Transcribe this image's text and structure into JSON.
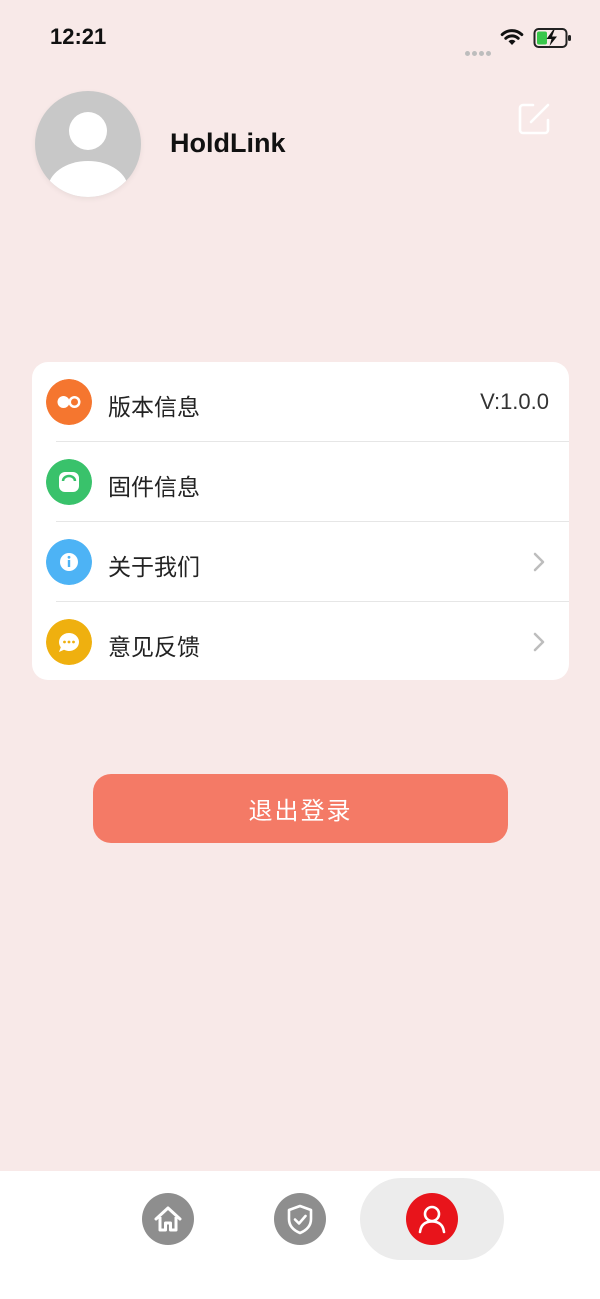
{
  "status_bar": {
    "time": "12:21",
    "icons": [
      "signal-dots-icon",
      "wifi-icon",
      "battery-charging-icon"
    ]
  },
  "profile": {
    "username": "HoldLink",
    "avatar_icon": "user-avatar-placeholder",
    "edit_icon": "edit-icon"
  },
  "menu": {
    "items": [
      {
        "label": "版本信息",
        "value": "V:1.0.0",
        "icon": "version-icon",
        "icon_color": "#f5762f",
        "chevron": false
      },
      {
        "label": "固件信息",
        "value": "",
        "icon": "firmware-icon",
        "icon_color": "#39c26b",
        "chevron": false
      },
      {
        "label": "关于我们",
        "value": "",
        "icon": "info-icon",
        "icon_color": "#4db3f5",
        "chevron": true
      },
      {
        "label": "意见反馈",
        "value": "",
        "icon": "feedback-icon",
        "icon_color": "#efb00f",
        "chevron": true
      }
    ]
  },
  "logout": {
    "label": "退出登录",
    "color": "#f47a66"
  },
  "tabbar": {
    "tabs": [
      {
        "name": "home",
        "icon": "home-icon",
        "active": false
      },
      {
        "name": "security",
        "icon": "shield-icon",
        "active": false
      },
      {
        "name": "profile",
        "icon": "user-icon",
        "active": true
      }
    ],
    "active_color": "#e8141b",
    "inactive_color": "#8e8e8e"
  },
  "colors": {
    "background": "#f8e9e8",
    "card": "#ffffff"
  }
}
